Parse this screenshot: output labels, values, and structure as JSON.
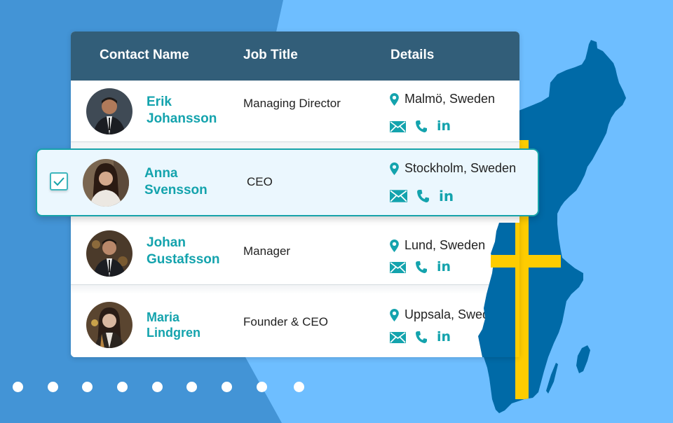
{
  "colors": {
    "background_dark": "#4394d6",
    "background_light": "#6ebeff",
    "header": "#325e79",
    "accent": "#14a3ad",
    "map_blue": "#006aa7",
    "flag_yellow": "#fecc00"
  },
  "table": {
    "columns": [
      "Contact Name",
      "Job Title",
      "Details"
    ],
    "rows": [
      {
        "first_name": "Erik",
        "last_name": "Johansson",
        "job_title": "Managing Director",
        "location": "Malmö, Sweden",
        "selected": false
      },
      {
        "first_name": "Anna",
        "last_name": "Svensson",
        "job_title": "CEO",
        "location": "Stockholm, Sweden",
        "selected": true
      },
      {
        "first_name": "Johan",
        "last_name": "Gustafsson",
        "job_title": "Manager",
        "location": "Lund, Sweden",
        "selected": false
      },
      {
        "first_name": "Maria",
        "last_name": "Lindgren",
        "job_title": "Founder & CEO",
        "location": "Uppsala, Sweden",
        "selected": false
      }
    ]
  },
  "icons": {
    "location": "map-pin-icon",
    "email": "envelope-icon",
    "phone": "phone-icon",
    "linkedin": "linkedin-icon",
    "linkedin_glyph": "in",
    "checkbox": "checkmark-icon"
  },
  "decor": {
    "dot_count": 9,
    "map": "sweden-map-with-flag"
  }
}
